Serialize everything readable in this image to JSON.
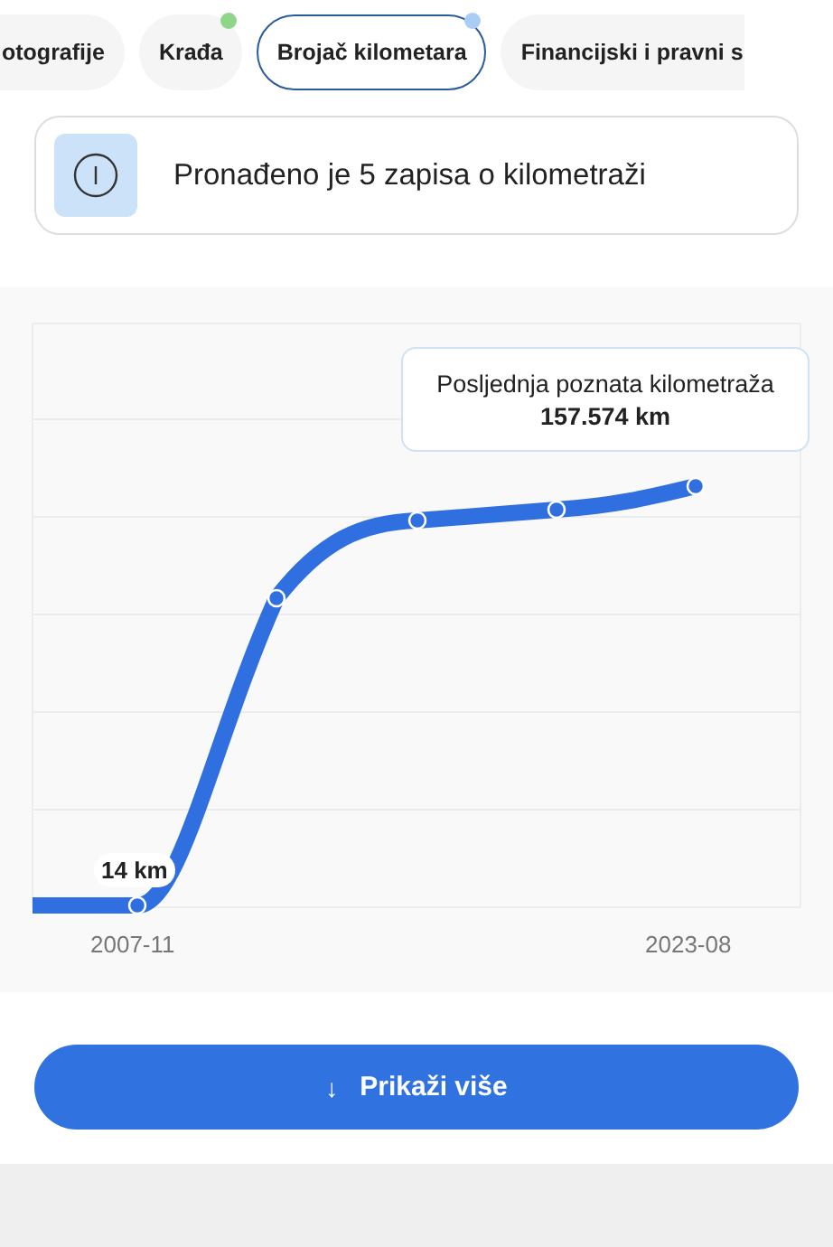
{
  "tabs": [
    {
      "label": "otografije",
      "selected": false
    },
    {
      "label": "Krađa",
      "selected": false,
      "color": "#8fd68a"
    },
    {
      "label": "Brojač kilometara",
      "selected": true,
      "color": "#a9cdf5"
    },
    {
      "label": "Financijski i pravni s",
      "selected": false
    }
  ],
  "info": {
    "text": "Pronađeno je 5 zapisa o kilometraži"
  },
  "chart": {
    "tooltip_title": "Posljednja poznata kilometraža",
    "tooltip_value": "157.574 km",
    "first_label": "14 km",
    "x_start": "2007-11",
    "x_end": "2023-08"
  },
  "button": {
    "icon": "↓",
    "label": "Prikaži više"
  }
}
